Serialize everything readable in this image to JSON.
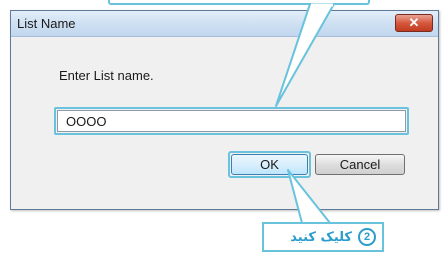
{
  "dialog": {
    "title": "List Name",
    "close_symbol": "✕",
    "prompt": "Enter List name.",
    "input_value": "OOOO",
    "ok_label": "OK",
    "cancel_label": "Cancel"
  },
  "callout": {
    "step_number": "2",
    "instruction": "کلیک کنید"
  },
  "colors": {
    "highlight": "#69c3dd",
    "step_accent": "#2a9ccd"
  }
}
